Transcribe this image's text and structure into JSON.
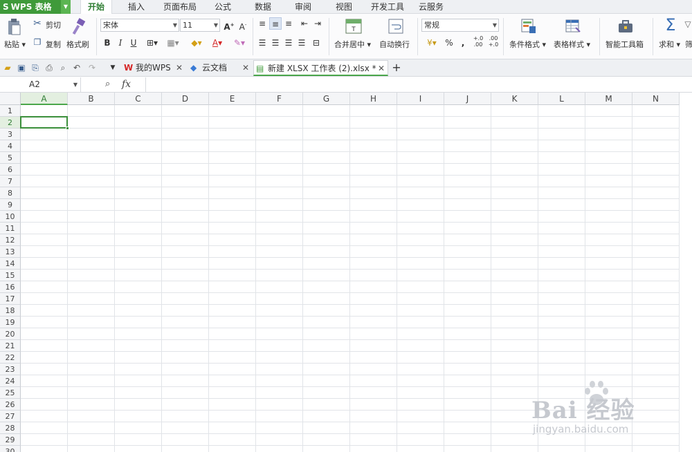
{
  "app": {
    "logo": "S",
    "name": "WPS 表格"
  },
  "menu": {
    "tabs": [
      "开始",
      "插入",
      "页面布局",
      "公式",
      "数据",
      "审阅",
      "视图",
      "开发工具",
      "云服务"
    ],
    "active_index": 0
  },
  "ribbon": {
    "paste": "粘贴",
    "cut": "剪切",
    "copy": "复制",
    "format_painter": "格式刷",
    "font_name": "宋体",
    "font_size": "11",
    "merge_center": "合并居中",
    "wrap_text": "自动换行",
    "number_format": "常规",
    "conditional_format": "条件格式",
    "table_style": "表格样式",
    "smart_toolbox": "智能工具箱",
    "sum": "求和",
    "filter_partial": "筛",
    "bold": "B",
    "italic": "I",
    "underline": "U",
    "percent": "%",
    "comma": ",",
    "inc_decimal": "+.0 .00",
    "dec_decimal": ".00 +.0"
  },
  "doc_tabs": [
    {
      "label": "我的WPS",
      "icon": "wps-logo-icon"
    },
    {
      "label": "云文档",
      "icon": "cloud-doc-icon"
    },
    {
      "label": "新建 XLSX 工作表 (2).xlsx *",
      "icon": "xlsx-file-icon",
      "active": true
    }
  ],
  "formula_bar": {
    "name_box": "A2",
    "fx": "fx",
    "value": ""
  },
  "sheet": {
    "columns": [
      "A",
      "B",
      "C",
      "D",
      "E",
      "F",
      "G",
      "H",
      "I",
      "J",
      "K",
      "L",
      "M",
      "N"
    ],
    "rows": [
      "1",
      "2",
      "3",
      "4",
      "5",
      "6",
      "7",
      "8",
      "9",
      "10",
      "11",
      "12",
      "13",
      "14",
      "15",
      "16",
      "17",
      "18",
      "19",
      "20",
      "21",
      "22",
      "23",
      "24",
      "25",
      "26",
      "27",
      "28",
      "29",
      "30"
    ],
    "selected_cell": "A2",
    "selected_col": "A",
    "selected_row": "2"
  },
  "watermark": {
    "brand": "Bai  经验",
    "url": "jingyan.baidu.com"
  },
  "colors": {
    "accent": "#3f9a3a",
    "selection": "#3b8f3b"
  }
}
